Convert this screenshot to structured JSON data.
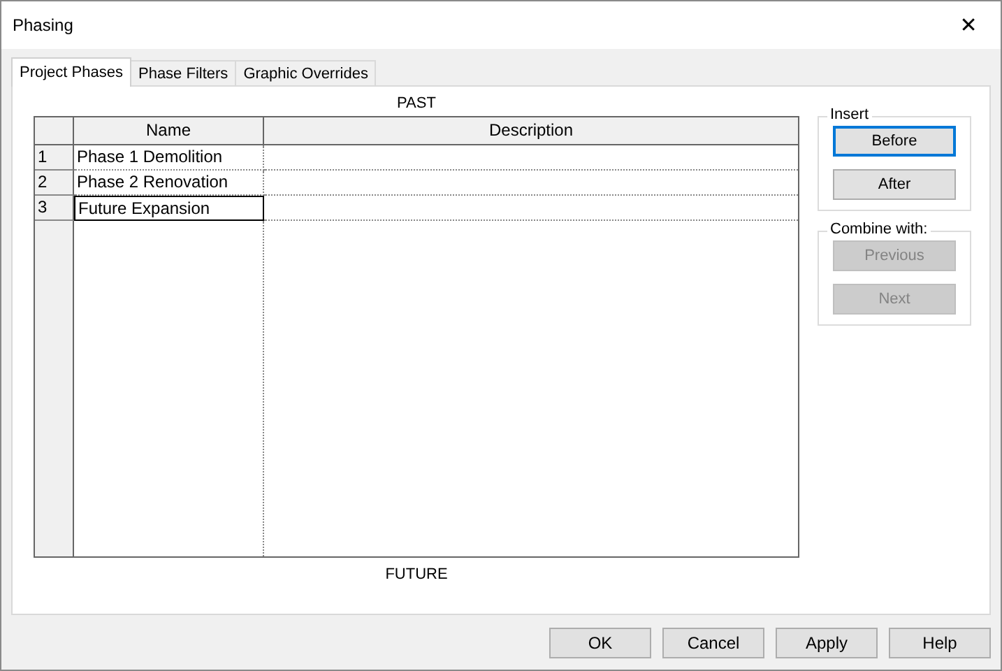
{
  "window": {
    "title": "Phasing",
    "close": "✕"
  },
  "tabs": [
    {
      "label": "Project Phases",
      "selected": true
    },
    {
      "label": "Phase Filters",
      "selected": false
    },
    {
      "label": "Graphic Overrides",
      "selected": false
    }
  ],
  "past_label": "PAST",
  "future_label": "FUTURE",
  "table": {
    "columns": [
      "Name",
      "Description"
    ],
    "rows": [
      {
        "number": "1",
        "name": "Phase 1 Demolition",
        "selected": false
      },
      {
        "number": "2",
        "name": "Phase 2 Renovation",
        "selected": false
      },
      {
        "number": "3",
        "name": "Future Expansion",
        "selected": true
      }
    ]
  },
  "groups": [
    {
      "title": "Insert",
      "buttons": [
        {
          "label": "Before",
          "disabled": false,
          "focused": true
        },
        {
          "label": "After",
          "disabled": false,
          "focused": false
        }
      ]
    },
    {
      "title": "Combine with:",
      "buttons": [
        {
          "label": "Previous",
          "disabled": true,
          "focused": false
        },
        {
          "label": "Next",
          "disabled": true,
          "focused": false
        }
      ]
    }
  ],
  "footer_buttons": [
    "OK",
    "Cancel",
    "Apply",
    "Help"
  ]
}
